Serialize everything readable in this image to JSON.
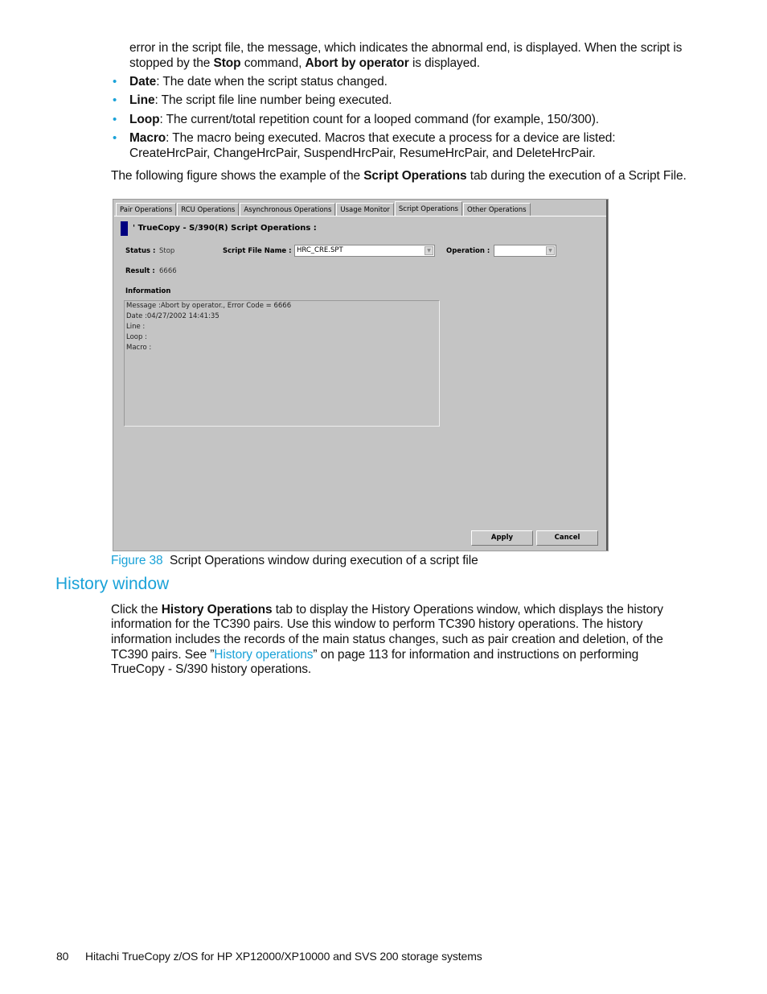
{
  "intro": {
    "line1": "error in the script file, the message, which indicates the abnormal end, is displayed. When the script is",
    "line2_a": "stopped by the ",
    "line2_b": "Stop",
    "line2_c": " command, ",
    "line2_d": "Abort by operator",
    "line2_e": " is displayed."
  },
  "bullets": [
    {
      "term": "Date",
      "text": ": The date when the script status changed."
    },
    {
      "term": "Line",
      "text": ": The script file line number being executed."
    },
    {
      "term": "Loop",
      "text": ": The current/total repetition count for a looped command (for example, 150/300)."
    },
    {
      "term": "Macro",
      "text": ": The macro being executed. Macros that execute a process for a device are listed:",
      "text2": "CreateHrcPair, ChangeHrcPair, SuspendHrcPair, ResumeHrcPair, and DeleteHrcPair."
    }
  ],
  "bullet_glyph": "•",
  "figure_intro": {
    "a": "The following figure shows the example of the ",
    "b": "Script Operations",
    "c": " tab during the execution of a Script File."
  },
  "window": {
    "tabs": [
      "Pair Operations",
      "RCU Operations",
      "Asynchronous Operations",
      "Usage Monitor",
      "Script Operations",
      "Other Operations"
    ],
    "active_tab": "Script Operations",
    "title": "' TrueCopy - S/390(R) Script Operations  :",
    "status_label": "Status :",
    "status_value": "Stop",
    "script_file_label": "Script File Name :",
    "script_file_value": "HRC_CRE.SPT",
    "operation_label": "Operation :",
    "operation_value": "",
    "result_label": "Result :",
    "result_value": "6666",
    "information_label": "Information",
    "information_lines": [
      "Message :Abort by operator., Error Code = 6666",
      "Date :04/27/2002 14:41:35",
      "Line :",
      "Loop :",
      "Macro :"
    ],
    "apply_label": "Apply",
    "cancel_label": "Cancel",
    "dropdown_arrow": "▼"
  },
  "caption": {
    "label": "Figure 38",
    "text": "Script Operations window during execution of a script file"
  },
  "section": {
    "heading": "History window",
    "p_a": "Click the ",
    "p_b": "History Operations",
    "p_c": " tab to display the History Operations window, which displays the history",
    "line2": "information for the TC390 pairs. Use this window to perform TC390 history operations. The history",
    "line3": "information includes the records of the main status changes, such as pair creation and deletion, of the",
    "line4_a": "TC390 pairs. See ”",
    "line4_link": "History operations",
    "line4_b": "” on page 113 for information and instructions on performing",
    "line5": "TrueCopy - S/390 history operations."
  },
  "footer": {
    "page_number": "80",
    "title": "Hitachi TrueCopy z/OS for HP XP12000/XP10000 and SVS 200 storage systems"
  },
  "colors": {
    "accent": "#1aa2d8",
    "window_bg": "#c4c4c4",
    "marker": "#000080"
  }
}
